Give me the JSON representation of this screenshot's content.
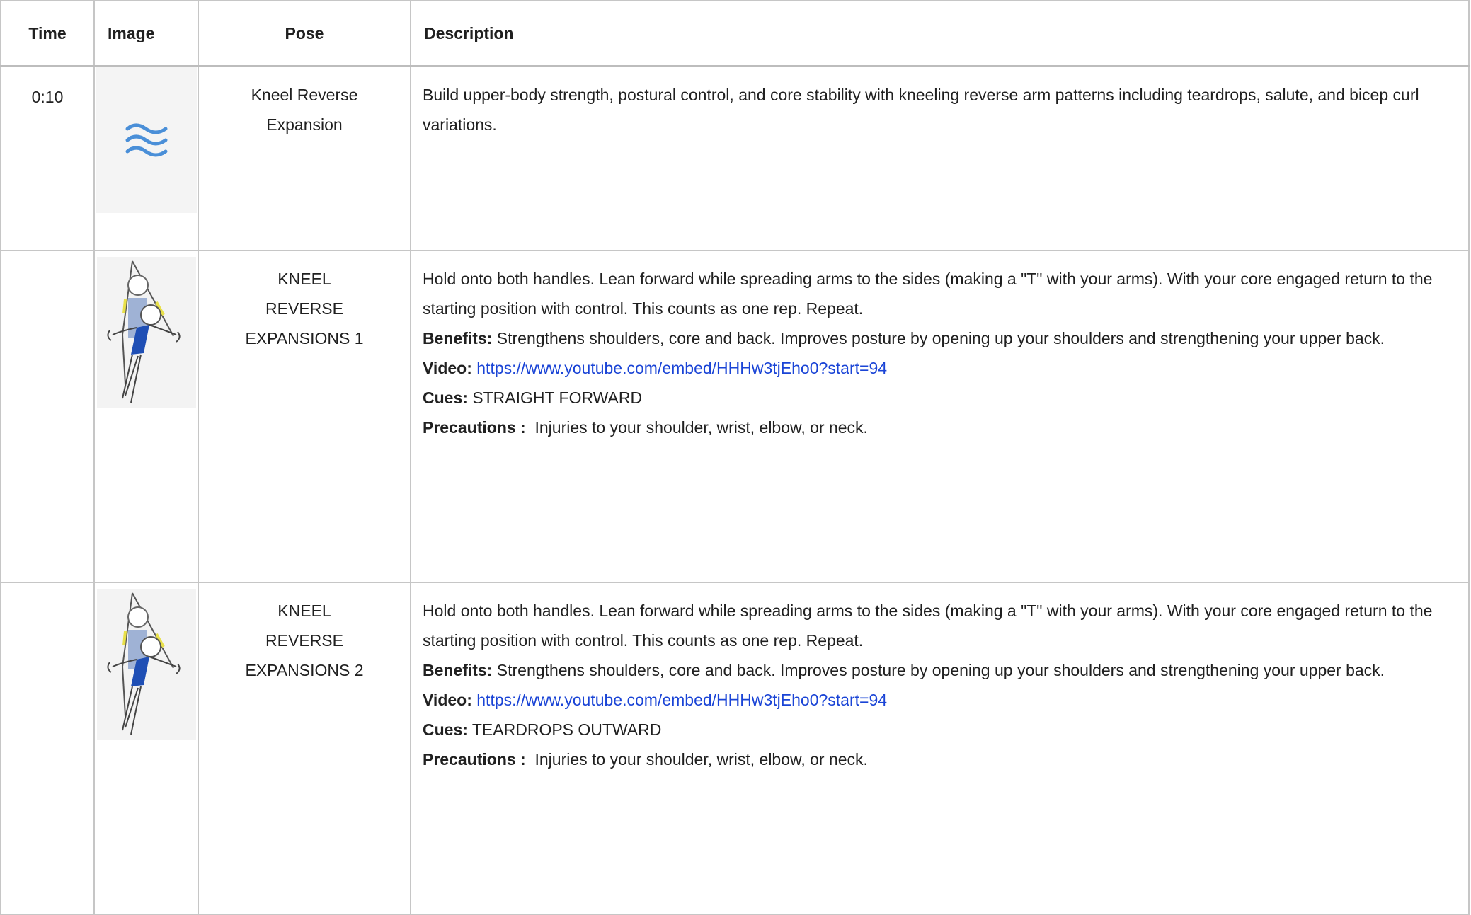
{
  "header": {
    "time": "Time",
    "image": "Image",
    "pose": "Pose",
    "description": "Description"
  },
  "section": {
    "time": "0:10",
    "image_icon": "wave-icon",
    "pose": "Kneel Reverse Expansion",
    "description": "Build upper-body strength, postural control, and core stability with kneeling reverse arm patterns including teardrops, salute, and bicep curl variations."
  },
  "exercises": [
    {
      "time": "",
      "image_icon": "suspension-trainer-figure",
      "pose_lines": [
        "KNEEL",
        "REVERSE",
        "EXPANSIONS 1"
      ],
      "description": "Hold onto both handles. Lean forward while spreading arms to the sides (making a \"T\" with your arms). With your core engaged return to the starting position with control. This counts as one rep. Repeat.",
      "benefits_label": "Benefits:",
      "benefits": " Strengthens shoulders, core and back. Improves posture by opening up your shoulders and strengthening your upper back.",
      "video_label": "Video:",
      "video_url": "https://www.youtube.com/embed/HHHw3tjEho0?start=94",
      "cues_label": "Cues:",
      "cues": " STRAIGHT FORWARD",
      "precautions_label": "Precautions :",
      "precautions": "  Injuries to your shoulder, wrist, elbow, or neck."
    },
    {
      "time": "",
      "image_icon": "suspension-trainer-figure",
      "pose_lines": [
        "KNEEL",
        "REVERSE",
        "EXPANSIONS 2"
      ],
      "description": "Hold onto both handles. Lean forward while spreading arms to the sides (making a \"T\" with your arms). With your core engaged return to the starting position with control. This counts as one rep. Repeat.",
      "benefits_label": "Benefits:",
      "benefits": " Strengthens shoulders, core and back. Improves posture by opening up your shoulders and strengthening your upper back.",
      "video_label": "Video:",
      "video_url": "https://www.youtube.com/embed/HHHw3tjEho0?start=94",
      "cues_label": "Cues:",
      "cues": " TEARDROPS OUTWARD",
      "precautions_label": "Precautions :",
      "precautions": "  Injuries to your shoulder, wrist, elbow, or neck."
    }
  ],
  "colors": {
    "link": "#1a44d6",
    "wave": "#4a8fd8",
    "shirt": "#1f4fb5",
    "strap_accent": "#e8e04a",
    "border": "#c6c6c6"
  }
}
